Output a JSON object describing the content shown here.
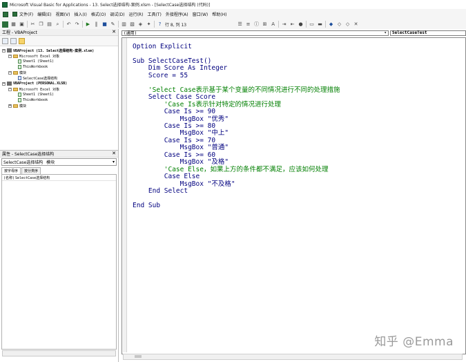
{
  "window": {
    "title": "Microsoft Visual Basic for Applications - 13. Select选择结构-案例.xlsm - [SelectCase选择结构 (代码)]"
  },
  "menubar": {
    "items": [
      "文件(F)",
      "编辑(E)",
      "视图(V)",
      "插入(I)",
      "格式(O)",
      "调试(D)",
      "运行(R)",
      "工具(T)",
      "外接程序(A)",
      "窗口(W)",
      "帮助(H)"
    ]
  },
  "toolbar": {
    "position_text": "行 8, 列 13"
  },
  "project_panel": {
    "title": "工程 - VBAProject",
    "tree": [
      {
        "label": "VBAProject (13. Select选择结构-案例.xlsm)",
        "bold": true
      },
      {
        "label": "Microsoft Excel 对象"
      },
      {
        "label": "Sheet1 (Sheet1)"
      },
      {
        "label": "ThisWorkbook"
      },
      {
        "label": "模块"
      },
      {
        "label": "SelectCase选择结构"
      },
      {
        "label": "VBAProject (PERSONAL.XLSB)",
        "bold": true
      },
      {
        "label": "Microsoft Excel 对象"
      },
      {
        "label": "Sheet1 (Sheet1)"
      },
      {
        "label": "ThisWorkbook"
      },
      {
        "label": "模块"
      }
    ]
  },
  "properties_panel": {
    "title": "属性 - SelectCase选择结构",
    "selected_object": "SelectCase选择结构",
    "selected_type": "模块",
    "tabs": [
      "按字母序",
      "按分类序"
    ],
    "rows": [
      {
        "name": "(名称)",
        "value": "SelectCase选择结构"
      }
    ]
  },
  "editor": {
    "object_combo": "(通用)",
    "procedure_combo": "SelectCaseTest",
    "lines": [
      {
        "text": "Option Explicit",
        "type": "code"
      },
      {
        "text": "",
        "type": "code"
      },
      {
        "text": "Sub SelectCaseTest()",
        "type": "code"
      },
      {
        "text": "    Dim Score As Integer",
        "type": "code"
      },
      {
        "text": "    Score = 55",
        "type": "code"
      },
      {
        "text": "",
        "type": "code"
      },
      {
        "text": "    'Select Case表示基于某个变量的不同情况进行不同的处理措施",
        "type": "comment"
      },
      {
        "text": "    Select Case Score",
        "type": "code"
      },
      {
        "text": "        'Case Is表示针对特定的情况进行处理",
        "type": "comment"
      },
      {
        "text": "        Case Is >= 90",
        "type": "code"
      },
      {
        "text": "            MsgBox \"优秀\"",
        "type": "code"
      },
      {
        "text": "        Case Is >= 80",
        "type": "code"
      },
      {
        "text": "            MsgBox \"中上\"",
        "type": "code"
      },
      {
        "text": "        Case Is >= 70",
        "type": "code"
      },
      {
        "text": "            MsgBox \"普通\"",
        "type": "code"
      },
      {
        "text": "        Case Is >= 60",
        "type": "code"
      },
      {
        "text": "            MsgBox \"及格\"",
        "type": "code"
      },
      {
        "text": "        'Case Else，如果上方的条件都不满足，应该如何处理",
        "type": "comment"
      },
      {
        "text": "        Case Else",
        "type": "code"
      },
      {
        "text": "            MsgBox \"不及格\"",
        "type": "code"
      },
      {
        "text": "    End Select",
        "type": "code"
      },
      {
        "text": "",
        "type": "code"
      },
      {
        "text": "End Sub",
        "type": "code"
      }
    ]
  },
  "watermark": "知乎 @Emma"
}
